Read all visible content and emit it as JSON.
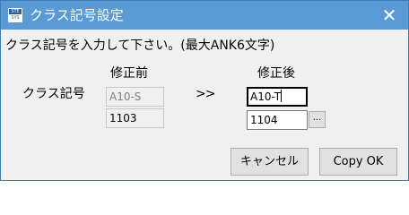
{
  "window": {
    "title": "クラス記号設定",
    "icon_top": "STE",
    "icon_bottom": "SYS",
    "close_glyph": "✕"
  },
  "instruction": "クラス記号を入力して下さい。(最大ANK6文字)",
  "columns": {
    "before": "修正前",
    "after": "修正後"
  },
  "row_label": "クラス記号",
  "before": {
    "class_code": "A10-S",
    "number": "1103"
  },
  "arrow": ">>",
  "after": {
    "class_code": "A10-T",
    "number": "1104"
  },
  "ellipsis_label": "...",
  "buttons": {
    "cancel": "キャンセル",
    "copy_ok": "Copy OK"
  },
  "colors": {
    "titlebar": "#5a9bd5",
    "dialog_bg": "#f0f0f0",
    "button_bg": "#e1e1e1"
  }
}
